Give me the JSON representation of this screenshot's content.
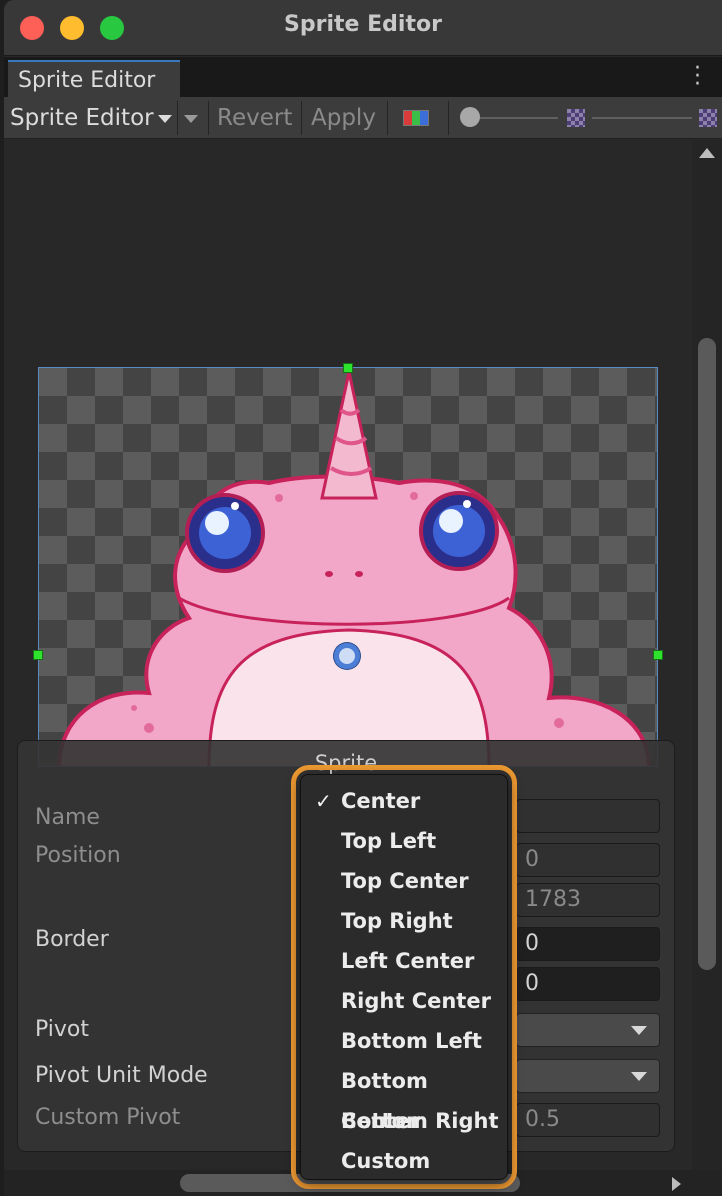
{
  "window": {
    "title": "Sprite Editor"
  },
  "tab": {
    "label": "Sprite Editor"
  },
  "toolbar": {
    "mode_label": "Sprite Editor",
    "revert_label": "Revert",
    "apply_label": "Apply"
  },
  "panel": {
    "title": "Sprite",
    "fields": {
      "name_label": "Name",
      "position_label": "Position",
      "position_y": "0",
      "position_h": "1783",
      "border_label": "Border",
      "border_top": "0",
      "border_bottom": "0",
      "pivot_label": "Pivot",
      "pivot_unit_mode_label": "Pivot Unit Mode",
      "custom_pivot_label": "Custom Pivot",
      "custom_pivot_y": "0.5"
    }
  },
  "pivot_menu": {
    "selected": "Center",
    "items": [
      "Center",
      "Top Left",
      "Top Center",
      "Top Right",
      "Left Center",
      "Right Center",
      "Bottom Left",
      "Bottom Center",
      "Bottom Right",
      "Custom"
    ]
  },
  "colors": {
    "accent_highlight": "#ef9a32",
    "selection_border": "#5a8bc0",
    "handle": "#2ee32e",
    "pivot": "#4d7ed6",
    "sprite_pink": "#f2a7c9",
    "sprite_outline": "#c8225a"
  },
  "icons": {
    "rgb_channels": "rgb-channel-icon",
    "zoom_small": "checker-small-icon",
    "zoom_large": "checker-large-icon",
    "menu": "kebab-menu-icon"
  }
}
